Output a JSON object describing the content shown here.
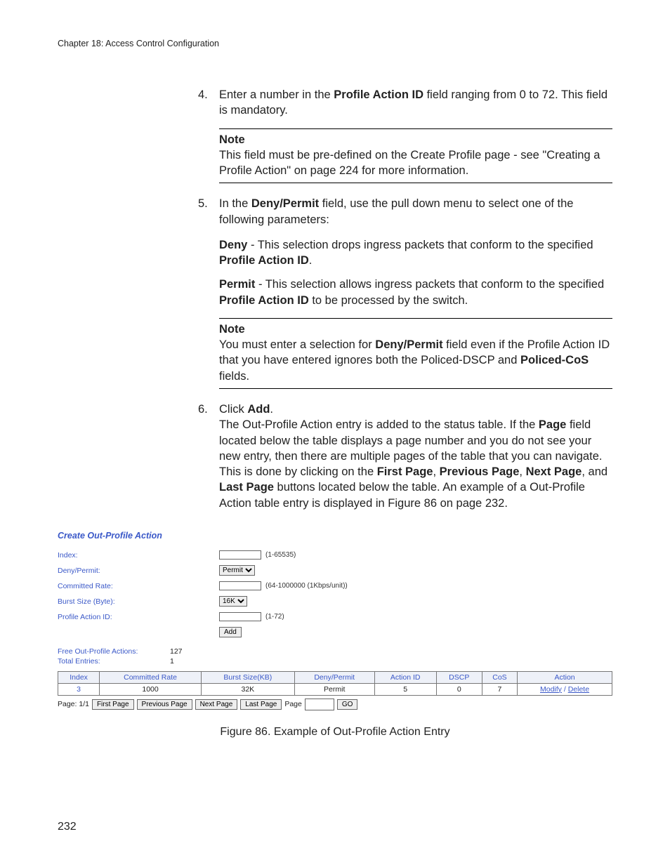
{
  "chapter": "Chapter 18: Access Control Configuration",
  "step4": {
    "num": "4.",
    "text_a": "Enter a number in the ",
    "bold_a": "Profile Action ID",
    "text_b": " field ranging from 0 to 72. This field is mandatory."
  },
  "note1": {
    "title": "Note",
    "text": "This field must be pre-defined on the Create Profile page - see \"Creating a Profile Action\" on page 224 for more information."
  },
  "step5": {
    "num": "5.",
    "text_a": "In the ",
    "bold_a": "Deny/Permit",
    "text_b": " field, use the pull down menu to select one of the following parameters:"
  },
  "deny": {
    "bold": "Deny",
    "text_a": " - This selection drops ingress packets that conform to the specified ",
    "bold_b": "Profile Action ID",
    "text_b": "."
  },
  "permit": {
    "bold": "Permit",
    "text_a": " - This selection allows ingress packets that conform to the specified ",
    "bold_b": "Profile Action ID",
    "text_b": " to be processed by the switch."
  },
  "note2": {
    "title": "Note",
    "text_a": "You must enter a selection for ",
    "bold_a": "Deny/Permit",
    "text_b": " field even if the Profile Action ID that you have entered ignores both the Policed-DSCP and ",
    "bold_b": "Policed-CoS",
    "text_c": " fields."
  },
  "step6": {
    "num": "6.",
    "text_a": "Click ",
    "bold_a": "Add",
    "text_b": ".",
    "body_a": "The Out-Profile Action entry is added to the status table. If the ",
    "bold_page": "Page",
    "body_b": " field located below the table displays a page number and you do not see your new entry, then there are multiple pages of the table that you can navigate. This is done by clicking on the ",
    "b_first": "First Page",
    "sep1": ", ",
    "b_prev": "Previous Page",
    "sep2": ", ",
    "b_next": "Next Page",
    "sep3": ", and ",
    "b_last": "Last Page",
    "body_c": " buttons located below the table. An example of a Out-Profile Action table entry is displayed in Figure 86 on page 232."
  },
  "figure": {
    "title": "Create Out-Profile Action",
    "labels": {
      "index": "Index:",
      "deny_permit": "Deny/Permit:",
      "committed_rate": "Committed Rate:",
      "burst_size": "Burst Size (Byte):",
      "profile_action_id": "Profile Action ID:"
    },
    "hints": {
      "index": "(1-65535)",
      "committed_rate": "(64-1000000 (1Kbps/unit))",
      "profile_action_id": "(1-72)"
    },
    "select": {
      "permit": "Permit",
      "burst": "16K"
    },
    "add_btn": "Add",
    "stats": {
      "free_label": "Free Out-Profile Actions:",
      "free_val": "127",
      "total_label": "Total Entries:",
      "total_val": "1"
    },
    "headers": [
      "Index",
      "Committed Rate",
      "Burst Size(KB)",
      "Deny/Permit",
      "Action ID",
      "DSCP",
      "CoS",
      "Action"
    ],
    "row": {
      "index": "3",
      "rate": "1000",
      "burst": "32K",
      "dp": "Permit",
      "aid": "5",
      "dscp": "0",
      "cos": "7",
      "modify": "Modify",
      "sep": " / ",
      "delete": "Delete"
    },
    "pager": {
      "page_label": "Page: 1/1",
      "first": "First Page",
      "prev": "Previous Page",
      "next": "Next Page",
      "last": "Last Page",
      "page_word": "Page",
      "go": "GO"
    }
  },
  "figcap": "Figure 86. Example of Out-Profile Action Entry",
  "page_number": "232"
}
